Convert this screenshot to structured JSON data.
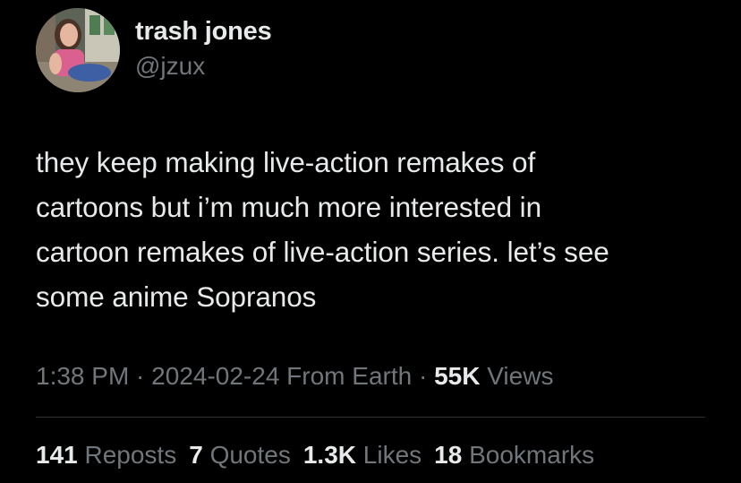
{
  "author": {
    "display_name": "trash jones",
    "handle": "@jzux",
    "avatar_icon": "profile-photo-avatar"
  },
  "tweet": {
    "text": "they keep making live-action remakes of\ncartoons but i’m much more interested in\ncartoon remakes of live-action series. let’s see\nsome anime Sopranos"
  },
  "meta": {
    "time": "1:38 PM",
    "separator": " · ",
    "date": "2024-02-24",
    "source": " From Earth",
    "views_count": "55K",
    "views_label": " Views"
  },
  "stats": [
    {
      "count": "141",
      "label": " Reposts"
    },
    {
      "count": "7",
      "label": " Quotes"
    },
    {
      "count": "1.3K",
      "label": " Likes"
    },
    {
      "count": "18",
      "label": " Bookmarks"
    }
  ],
  "colors": {
    "background": "#000000",
    "primary_text": "#e7e9ea",
    "secondary_text": "#71767b",
    "divider": "#2f3336"
  }
}
